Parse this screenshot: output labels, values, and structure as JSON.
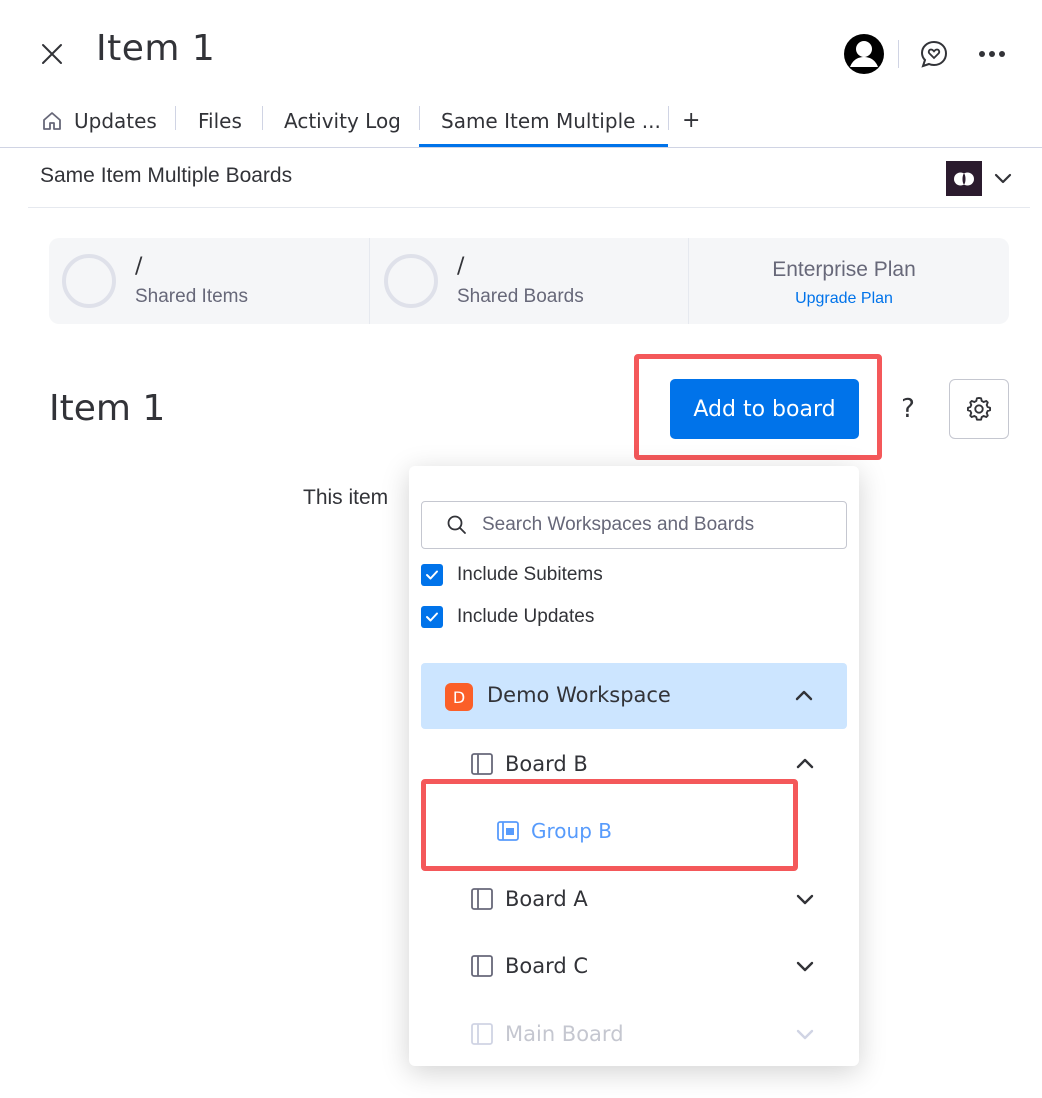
{
  "header": {
    "title": "Item 1",
    "close_icon": "close-icon",
    "avatar_icon": "user-avatar-icon",
    "chat_icon": "chat-heart-icon",
    "more_icon": "more-horizontal-icon"
  },
  "tabs": [
    {
      "label": "Updates",
      "icon": "home-icon"
    },
    {
      "label": "Files"
    },
    {
      "label": "Activity Log"
    },
    {
      "label": "Same Item Multiple ...",
      "active": true
    }
  ],
  "tab_add_label": "+",
  "app": {
    "title": "Same Item Multiple Boards",
    "logo_icon": "app-logo-icon",
    "dropdown_icon": "chevron-down-icon"
  },
  "stats": {
    "shared_items": {
      "value": "/",
      "label": "Shared Items"
    },
    "shared_boards": {
      "value": "/",
      "label": "Shared Boards"
    },
    "plan": {
      "name": "Enterprise Plan",
      "link": "Upgrade Plan"
    }
  },
  "main": {
    "item_title": "Item 1",
    "add_button": "Add to board",
    "help_label": "?",
    "settings_icon": "gear-icon",
    "body_text": "This item"
  },
  "dropdown": {
    "search_placeholder": "Search Workspaces and Boards",
    "include_subitems": "Include Subitems",
    "include_updates": "Include Updates",
    "workspace": {
      "badge": "D",
      "label": "Demo Workspace",
      "color": "#fb5f28"
    },
    "boards": [
      {
        "label": "Board B",
        "expanded": true
      },
      {
        "label": "Board A",
        "expanded": false
      },
      {
        "label": "Board C",
        "expanded": false
      },
      {
        "label": "Main Board",
        "expanded": false,
        "disabled": true
      }
    ],
    "group": {
      "label": "Group B"
    }
  },
  "colors": {
    "accent": "#0073ea",
    "highlight": "#f4585a",
    "workspace_bg": "#cce5ff",
    "group_text": "#579bfc"
  }
}
